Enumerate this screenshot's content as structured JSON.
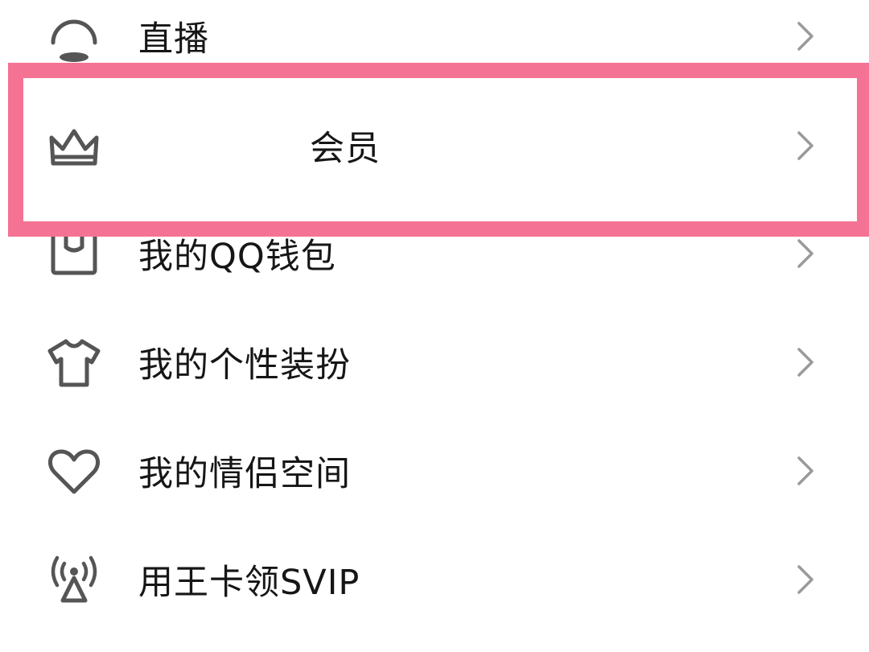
{
  "menu": {
    "items": [
      {
        "label": "直播",
        "icon": "live-broadcast-icon"
      },
      {
        "label": "会员",
        "icon": "crown-icon"
      },
      {
        "label": "我的QQ钱包",
        "icon": "wallet-icon"
      },
      {
        "label": "我的个性装扮",
        "icon": "tshirt-icon"
      },
      {
        "label": "我的情侣空间",
        "icon": "heart-icon"
      },
      {
        "label": "用王卡领SVIP",
        "icon": "signal-tower-icon"
      }
    ],
    "chevron_icon": "chevron-right-icon"
  },
  "colors": {
    "highlight_border": "#f47293",
    "icon_stroke": "#555555",
    "chevron": "#9a9a9a",
    "text": "#161616",
    "background": "#ffffff"
  }
}
